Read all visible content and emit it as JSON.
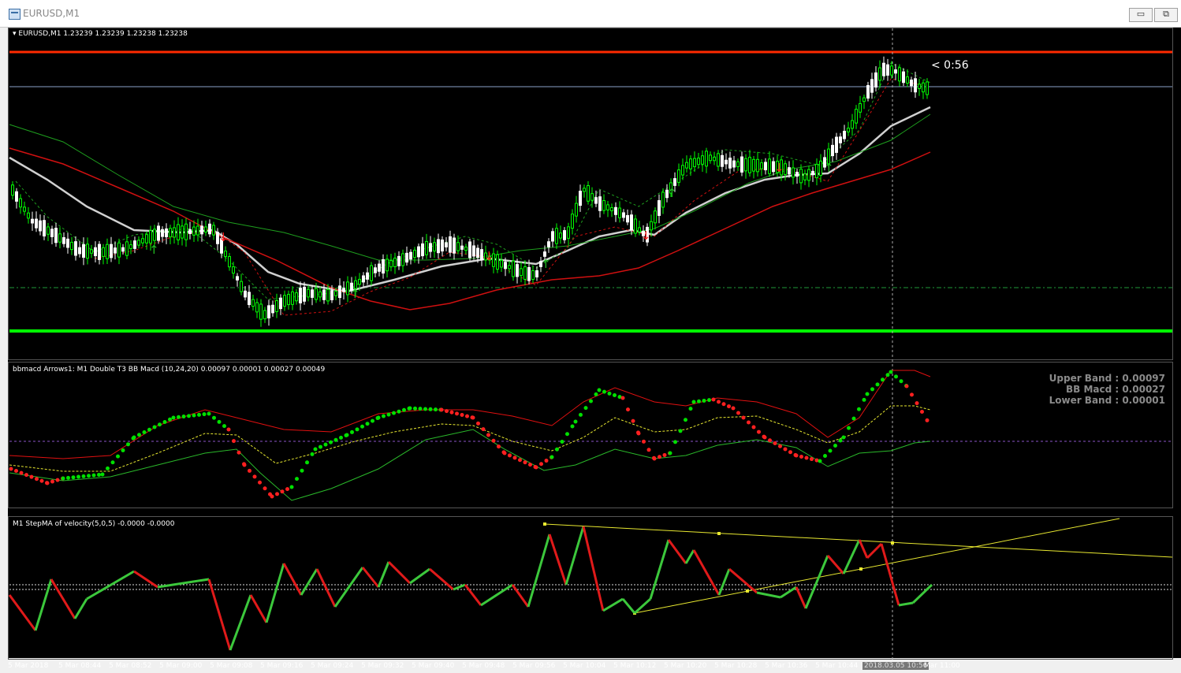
{
  "window": {
    "title": "EURUSD,M1",
    "minimize_label": "▭",
    "restore_label": "⧉"
  },
  "main_chart": {
    "symbol_label": "EURUSD,M1",
    "ohlc_label": "1.23239 1.23239 1.23238 1.23238",
    "timer_label": "< 0:56",
    "colors": {
      "bull": "#00ff00",
      "bear": "#ffffff",
      "resistance": "#ff2a00",
      "support": "#00ff00"
    }
  },
  "macd_panel": {
    "label": "bbmacd Arrows1: M1 Double T3 BB Macd (10,24,20) 0.00097 0.00001 0.00027 0.00049",
    "upper_band": "Upper Band : 0.00097",
    "bb_macd": "BB Macd : 0.00027",
    "lower_band": "Lower Band : 0.00001"
  },
  "velocity_panel": {
    "label": "M1 StepMA of velocity(5,0,5) -0.0000 -0.0000"
  },
  "time_axis": [
    "5 Mar 2018",
    "5 Mar 08:44",
    "5 Mar 08:52",
    "5 Mar 09:00",
    "5 Mar 09:08",
    "5 Mar 09:16",
    "5 Mar 09:24",
    "5 Mar 09:32",
    "5 Mar 09:40",
    "5 Mar 09:48",
    "5 Mar 09:56",
    "5 Mar 10:04",
    "5 Mar 10:12",
    "5 Mar 10:20",
    "5 Mar 10:28",
    "5 Mar 10:36",
    "5 Mar 10:44",
    "2018.03.05 10:56",
    "Mar 11:00"
  ]
}
